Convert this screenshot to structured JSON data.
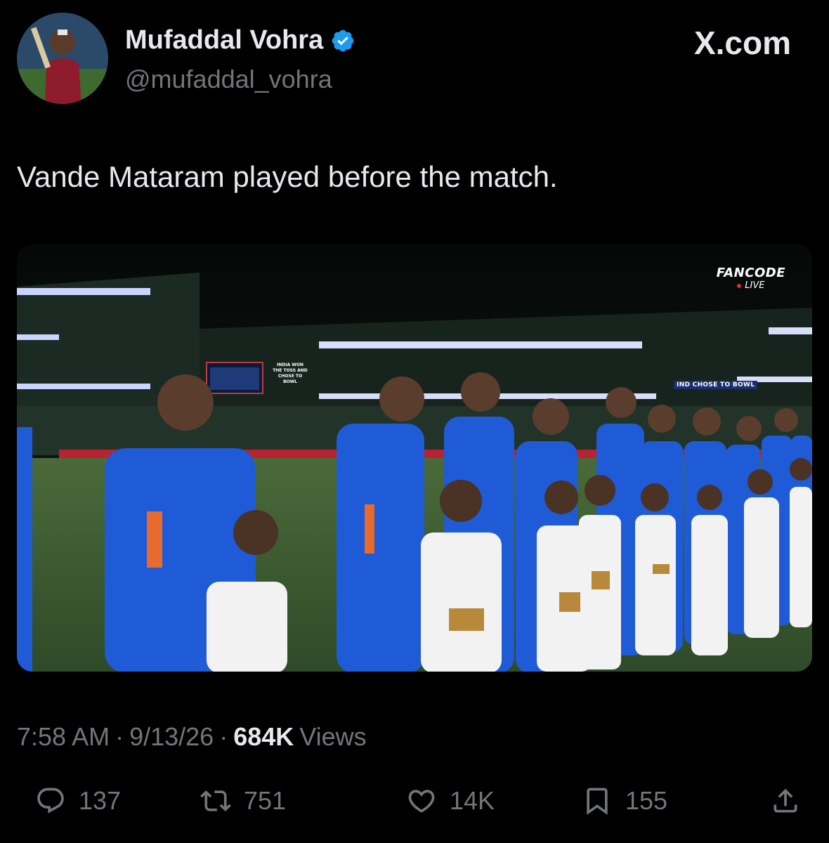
{
  "author": {
    "display_name": "Mufaddal Vohra",
    "handle": "@mufaddal_vohra",
    "verified_icon": "verified-badge-icon",
    "avatar_icon": "avatar"
  },
  "brand": {
    "label": "X.com"
  },
  "tweet": {
    "text": "Vande Mataram played before the match."
  },
  "media": {
    "broadcaster": "FANCODE",
    "live_label": "LIVE",
    "scoreboard_text": "INDIA WON THE TOSS AND CHOSE TO BOWL",
    "ad_board_text": "IND CHOSE TO BOWL"
  },
  "meta": {
    "time": "7:58 AM",
    "separator1": "·",
    "date": "9/13/26",
    "separator2": "·",
    "views_count": "684K",
    "views_label": "Views"
  },
  "actions": {
    "replies": {
      "icon": "reply-icon",
      "count": "137"
    },
    "reposts": {
      "icon": "repost-icon",
      "count": "751"
    },
    "likes": {
      "icon": "like-icon",
      "count": "14K"
    },
    "bookmarks": {
      "icon": "bookmark-icon",
      "count": "155"
    },
    "share": {
      "icon": "share-icon"
    }
  },
  "colors": {
    "background": "#000000",
    "primary_text": "#e7e9ea",
    "secondary_text": "#71767b",
    "verified_blue": "#1d9bf0",
    "jersey_blue": "#1f5bd6"
  }
}
